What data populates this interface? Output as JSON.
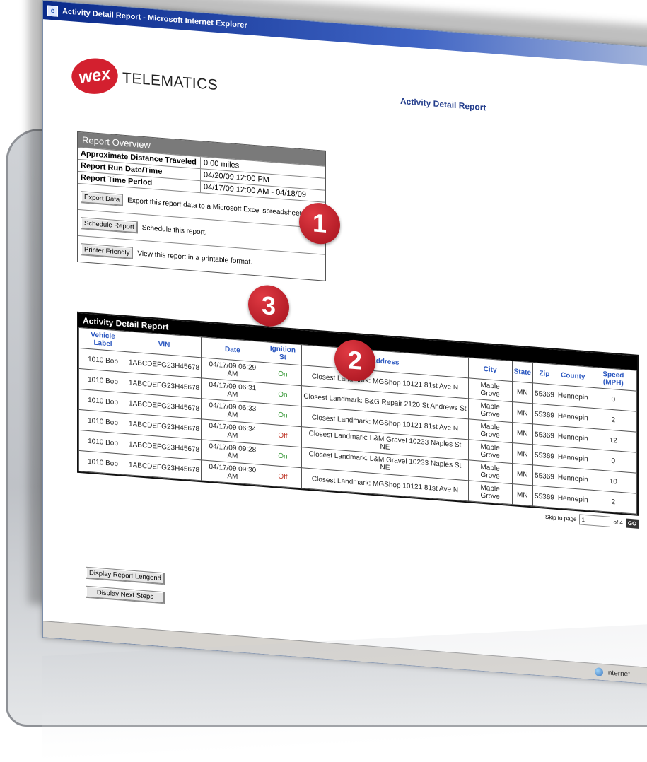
{
  "window": {
    "title": "Activity Detail Report - Microsoft Internet Explorer"
  },
  "brand": {
    "logo_text": "wex",
    "product": "TELEMATICS"
  },
  "page_title": "Activity Detail Report",
  "overview": {
    "heading": "Report Overview",
    "rows": [
      {
        "label": "Approximate Distance Traveled",
        "value": "0.00 miles"
      },
      {
        "label": "Report Run Date/Time",
        "value": "04/20/09 12:00 PM"
      },
      {
        "label": "Report Time Period",
        "value": "04/17/09 12:00 AM - 04/18/09"
      }
    ],
    "actions": [
      {
        "button": "Export Data",
        "description": "Export this report data to a Microsoft Excel spreadsheet."
      },
      {
        "button": "Schedule Report",
        "description": "Schedule this report."
      },
      {
        "button": "Printer Friendly",
        "description": "View this report in a printable format."
      }
    ]
  },
  "callouts": [
    "1",
    "2",
    "3"
  ],
  "grid": {
    "heading": "Activity Detail Report",
    "columns": [
      "Vehicle Label",
      "VIN",
      "Date",
      "Ignition St",
      "Address",
      "City",
      "State",
      "Zip",
      "County",
      "Speed (MPH)"
    ],
    "rows": [
      {
        "vehicle": "1010 Bob",
        "vin": "1ABCDEFG23H45678",
        "date": "04/17/09 06:29 AM",
        "ignition": "On",
        "address": "Closest Landmark: MGShop 10121 81st Ave N",
        "city": "Maple Grove",
        "state": "MN",
        "zip": "55369",
        "county": "Hennepin",
        "speed": "0"
      },
      {
        "vehicle": "1010 Bob",
        "vin": "1ABCDEFG23H45678",
        "date": "04/17/09 06:31 AM",
        "ignition": "On",
        "address": "Closest Landmark: B&G Repair 2120 St Andrews St",
        "city": "Maple Grove",
        "state": "MN",
        "zip": "55369",
        "county": "Hennepin",
        "speed": "2"
      },
      {
        "vehicle": "1010 Bob",
        "vin": "1ABCDEFG23H45678",
        "date": "04/17/09 06:33 AM",
        "ignition": "On",
        "address": "Closest Landmark: MGShop 10121 81st Ave N",
        "city": "Maple Grove",
        "state": "MN",
        "zip": "55369",
        "county": "Hennepin",
        "speed": "12"
      },
      {
        "vehicle": "1010 Bob",
        "vin": "1ABCDEFG23H45678",
        "date": "04/17/09 06:34 AM",
        "ignition": "Off",
        "address": "Closest Landmark: L&M Gravel 10233 Naples St NE",
        "city": "Maple Grove",
        "state": "MN",
        "zip": "55369",
        "county": "Hennepin",
        "speed": "0"
      },
      {
        "vehicle": "1010 Bob",
        "vin": "1ABCDEFG23H45678",
        "date": "04/17/09 09:28 AM",
        "ignition": "On",
        "address": "Closest Landmark: L&M Gravel 10233 Naples St NE",
        "city": "Maple Grove",
        "state": "MN",
        "zip": "55369",
        "county": "Hennepin",
        "speed": "10"
      },
      {
        "vehicle": "1010 Bob",
        "vin": "1ABCDEFG23H45678",
        "date": "04/17/09 09:30 AM",
        "ignition": "Off",
        "address": "Closest Landmark: MGShop 10121 81st Ave N",
        "city": "Maple Grove",
        "state": "MN",
        "zip": "55369",
        "county": "Hennepin",
        "speed": "2"
      }
    ]
  },
  "pager": {
    "label": "Skip to page",
    "value": "1",
    "of": "of 4",
    "go": "GO"
  },
  "footer_buttons": {
    "legend": "Display Report Lengend",
    "next_steps": "Display Next Steps"
  },
  "status": {
    "zone": "Internet"
  },
  "colors": {
    "callout": "#c41e2a",
    "header_link": "#2c58c0",
    "ignition_on": "#3a9a3a",
    "ignition_off": "#c0392b"
  }
}
